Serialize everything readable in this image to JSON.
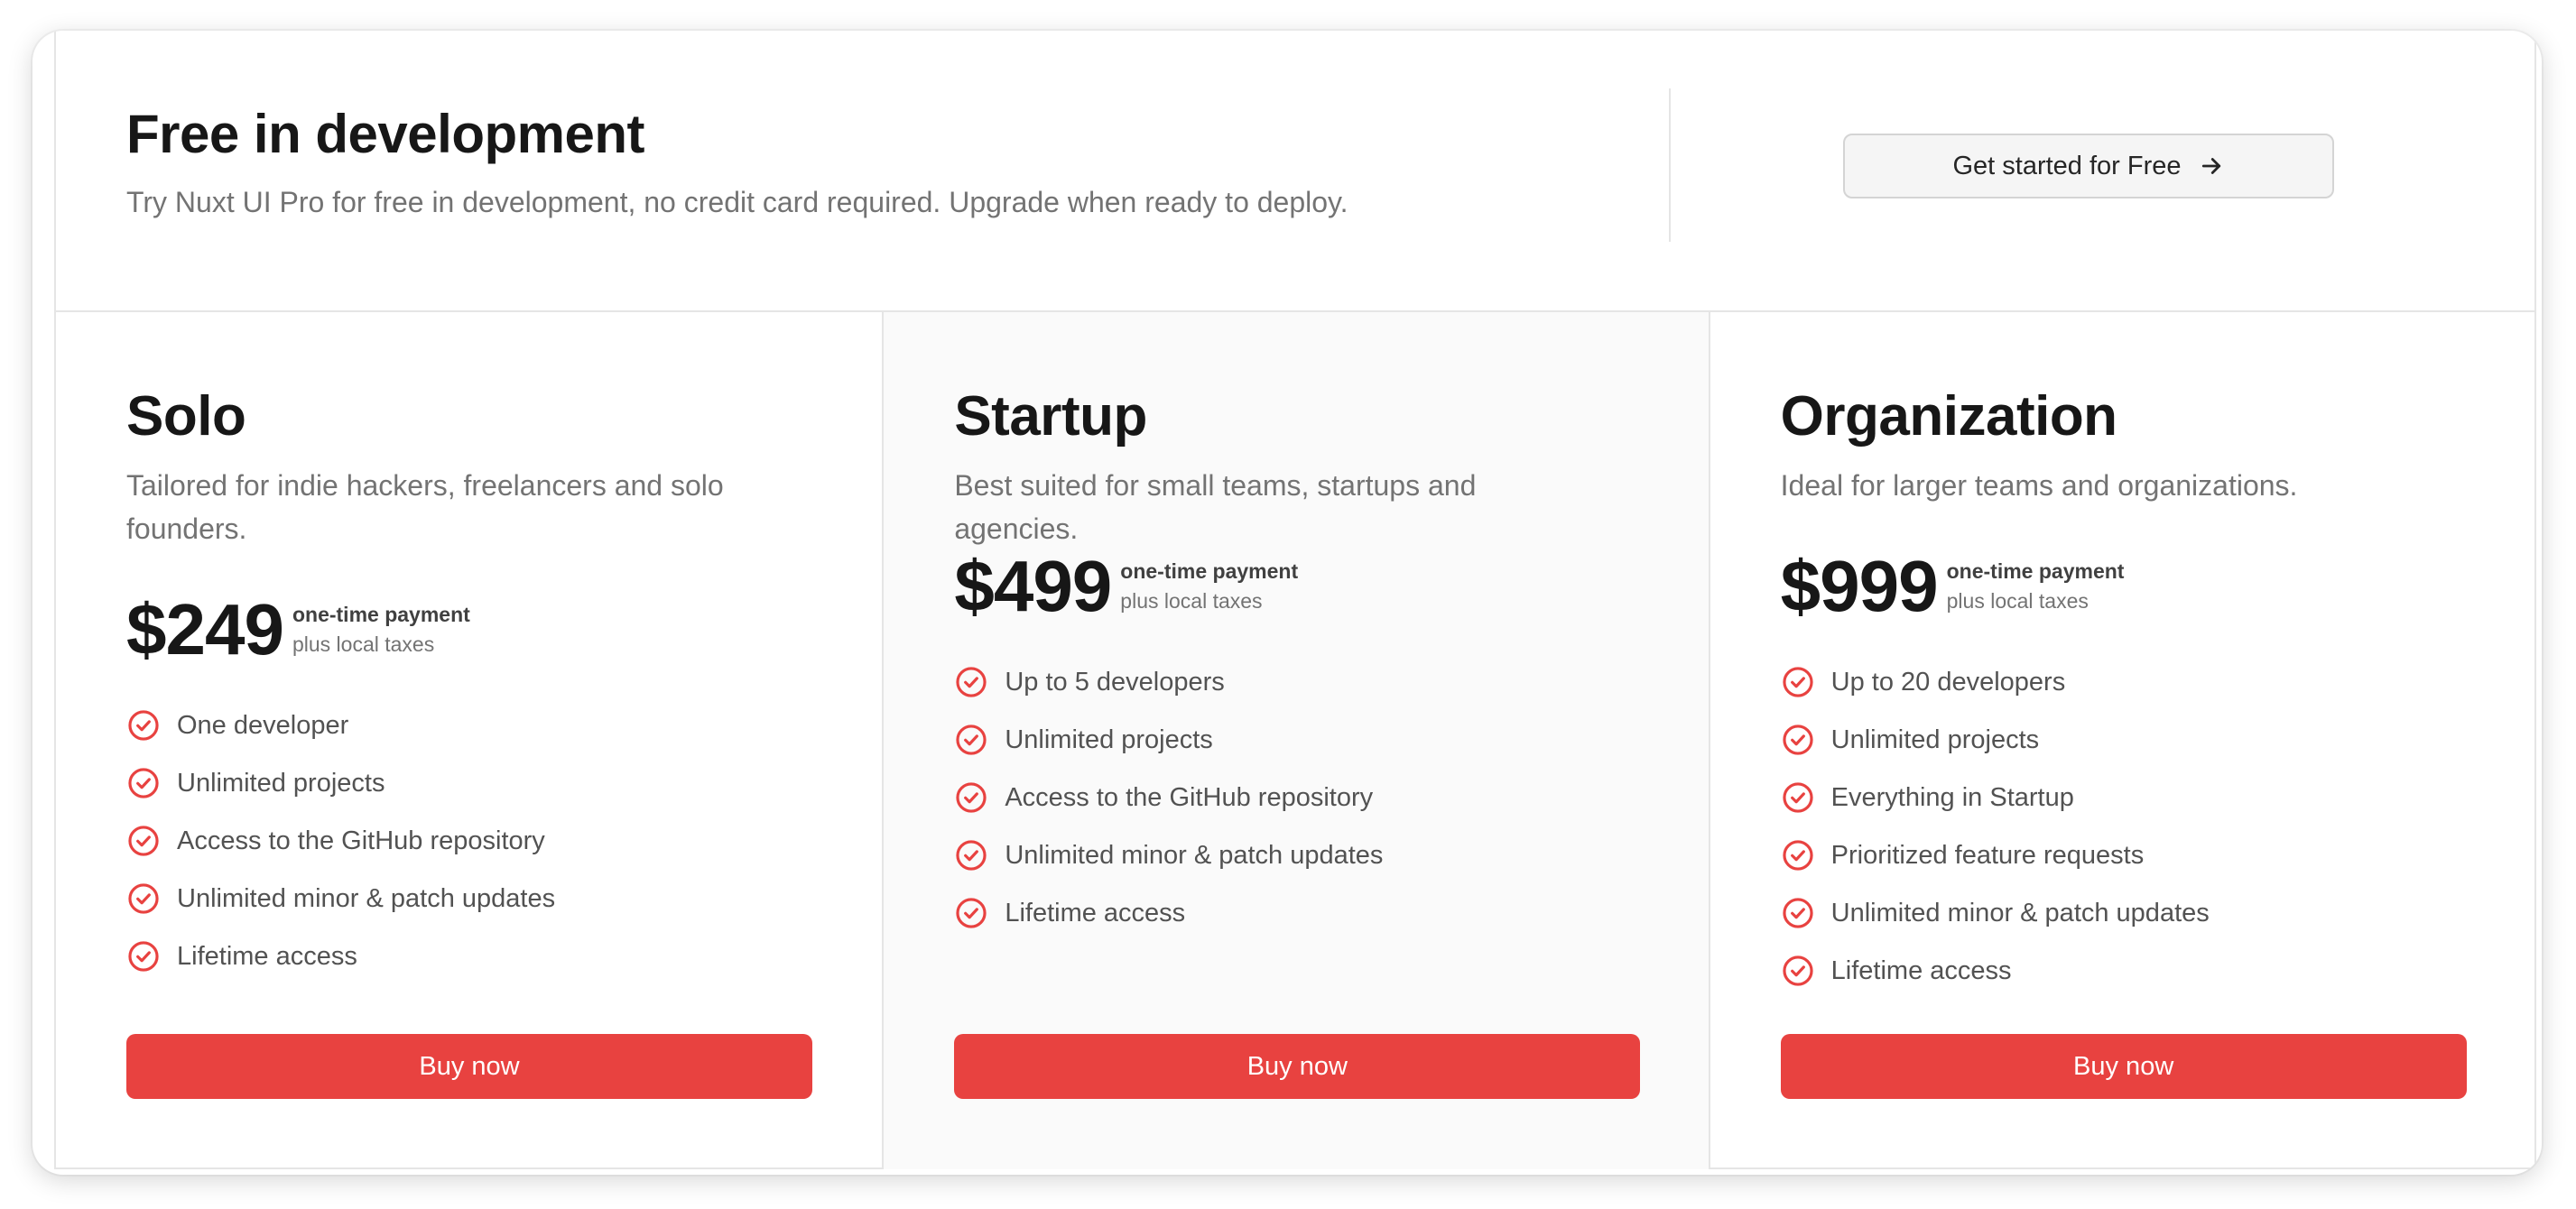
{
  "header": {
    "title": "Free in development",
    "description": "Try Nuxt UI Pro for free in development, no credit card required. Upgrade when ready to deploy.",
    "cta_label": "Get started for Free",
    "cta_icon": "arrow-right-icon"
  },
  "colors": {
    "accent": "#e84240",
    "muted_text": "#737373",
    "border": "#e5e5e5",
    "highlight_bg": "#fafafa"
  },
  "plans": [
    {
      "title": "Solo",
      "description": "Tailored for indie hackers, freelancers and solo founders.",
      "price": "$249",
      "price_note": "one-time payment",
      "tax_note": "plus local taxes",
      "features": [
        "One developer",
        "Unlimited projects",
        "Access to the GitHub repository",
        "Unlimited minor & patch updates",
        "Lifetime access"
      ],
      "button_label": "Buy now"
    },
    {
      "title": "Startup",
      "description": "Best suited for small teams, startups and agencies.",
      "price": "$499",
      "price_note": "one-time payment",
      "tax_note": "plus local taxes",
      "features": [
        "Up to 5 developers",
        "Unlimited projects",
        "Access to the GitHub repository",
        "Unlimited minor & patch updates",
        "Lifetime access"
      ],
      "button_label": "Buy now"
    },
    {
      "title": "Organization",
      "description": "Ideal for larger teams and organizations.",
      "price": "$999",
      "price_note": "one-time payment",
      "tax_note": "plus local taxes",
      "features": [
        "Up to 20 developers",
        "Unlimited projects",
        "Everything in Startup",
        "Prioritized feature requests",
        "Unlimited minor & patch updates",
        "Lifetime access"
      ],
      "button_label": "Buy now"
    }
  ]
}
